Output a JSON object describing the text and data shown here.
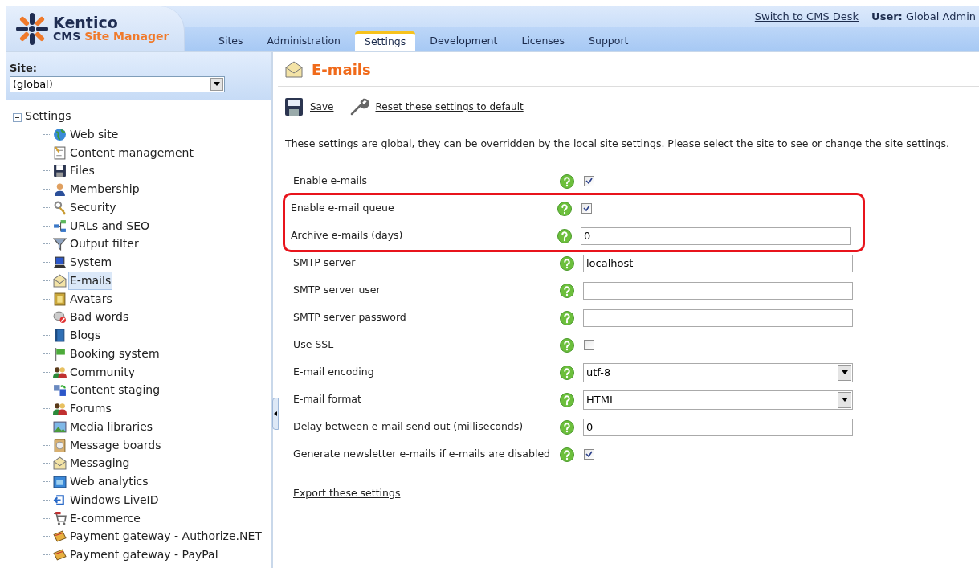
{
  "header": {
    "logo_title": "Kentico",
    "logo_subtitle_1": "CMS",
    "logo_subtitle_2": "Site Manager",
    "switch_link": "Switch to CMS Desk",
    "user_label": "User:",
    "user_name": "Global Admin"
  },
  "tabs": [
    {
      "label": "Sites",
      "selected": false
    },
    {
      "label": "Administration",
      "selected": false
    },
    {
      "label": "Settings",
      "selected": true
    },
    {
      "label": "Development",
      "selected": false
    },
    {
      "label": "Licenses",
      "selected": false
    },
    {
      "label": "Support",
      "selected": false
    }
  ],
  "sidebar": {
    "site_label": "Site:",
    "site_value": "(global)",
    "tree": {
      "label": "Settings",
      "expanded": true,
      "children": [
        {
          "label": "Web site",
          "selected": false
        },
        {
          "label": "Content management",
          "selected": false
        },
        {
          "label": "Files",
          "selected": false
        },
        {
          "label": "Membership",
          "selected": false
        },
        {
          "label": "Security",
          "selected": false
        },
        {
          "label": "URLs and SEO",
          "selected": false
        },
        {
          "label": "Output filter",
          "selected": false
        },
        {
          "label": "System",
          "selected": false
        },
        {
          "label": "E-mails",
          "selected": true
        },
        {
          "label": "Avatars",
          "selected": false
        },
        {
          "label": "Bad words",
          "selected": false
        },
        {
          "label": "Blogs",
          "selected": false
        },
        {
          "label": "Booking system",
          "selected": false
        },
        {
          "label": "Community",
          "selected": false
        },
        {
          "label": "Content staging",
          "selected": false
        },
        {
          "label": "Forums",
          "selected": false
        },
        {
          "label": "Media libraries",
          "selected": false
        },
        {
          "label": "Message boards",
          "selected": false
        },
        {
          "label": "Messaging",
          "selected": false
        },
        {
          "label": "Web analytics",
          "selected": false
        },
        {
          "label": "Windows LiveID",
          "selected": false
        },
        {
          "label": "E-commerce",
          "selected": false
        },
        {
          "label": "Payment gateway - Authorize.NET",
          "selected": false
        },
        {
          "label": "Payment gateway - PayPal",
          "selected": false
        }
      ]
    }
  },
  "main": {
    "title": "E-mails",
    "toolbar": [
      "Save",
      "Reset these settings to default"
    ],
    "intro": "These settings are global, they can be overridden by the local site settings. Please select the site to see or change the site settings.",
    "settings": [
      {
        "kind": "checkbox",
        "label": "Enable e-mails",
        "checked": true,
        "highlighted": false
      },
      {
        "kind": "checkbox",
        "label": "Enable e-mail queue",
        "checked": true,
        "highlighted": true
      },
      {
        "kind": "text",
        "label": "Archive e-mails (days)",
        "value": "0",
        "highlighted": true
      },
      {
        "kind": "text",
        "label": "SMTP server",
        "value": "localhost",
        "highlighted": false
      },
      {
        "kind": "text",
        "label": "SMTP server user",
        "highlighted": false
      },
      {
        "kind": "text",
        "label": "SMTP server password",
        "highlighted": false
      },
      {
        "kind": "checkbox",
        "label": "Use SSL",
        "checked": false,
        "highlighted": false
      },
      {
        "kind": "select",
        "label": "E-mail encoding",
        "value": "utf-8",
        "highlighted": false
      },
      {
        "kind": "select",
        "label": "E-mail format",
        "value": "HTML",
        "highlighted": false
      },
      {
        "kind": "text",
        "label": "Delay between e-mail send out (milliseconds)",
        "value": "0",
        "highlighted": false
      },
      {
        "kind": "checkbox",
        "label": "Generate newsletter e-mails if e-mails are disabled",
        "checked": true,
        "highlighted": false
      }
    ],
    "export_link": "Export these settings"
  }
}
